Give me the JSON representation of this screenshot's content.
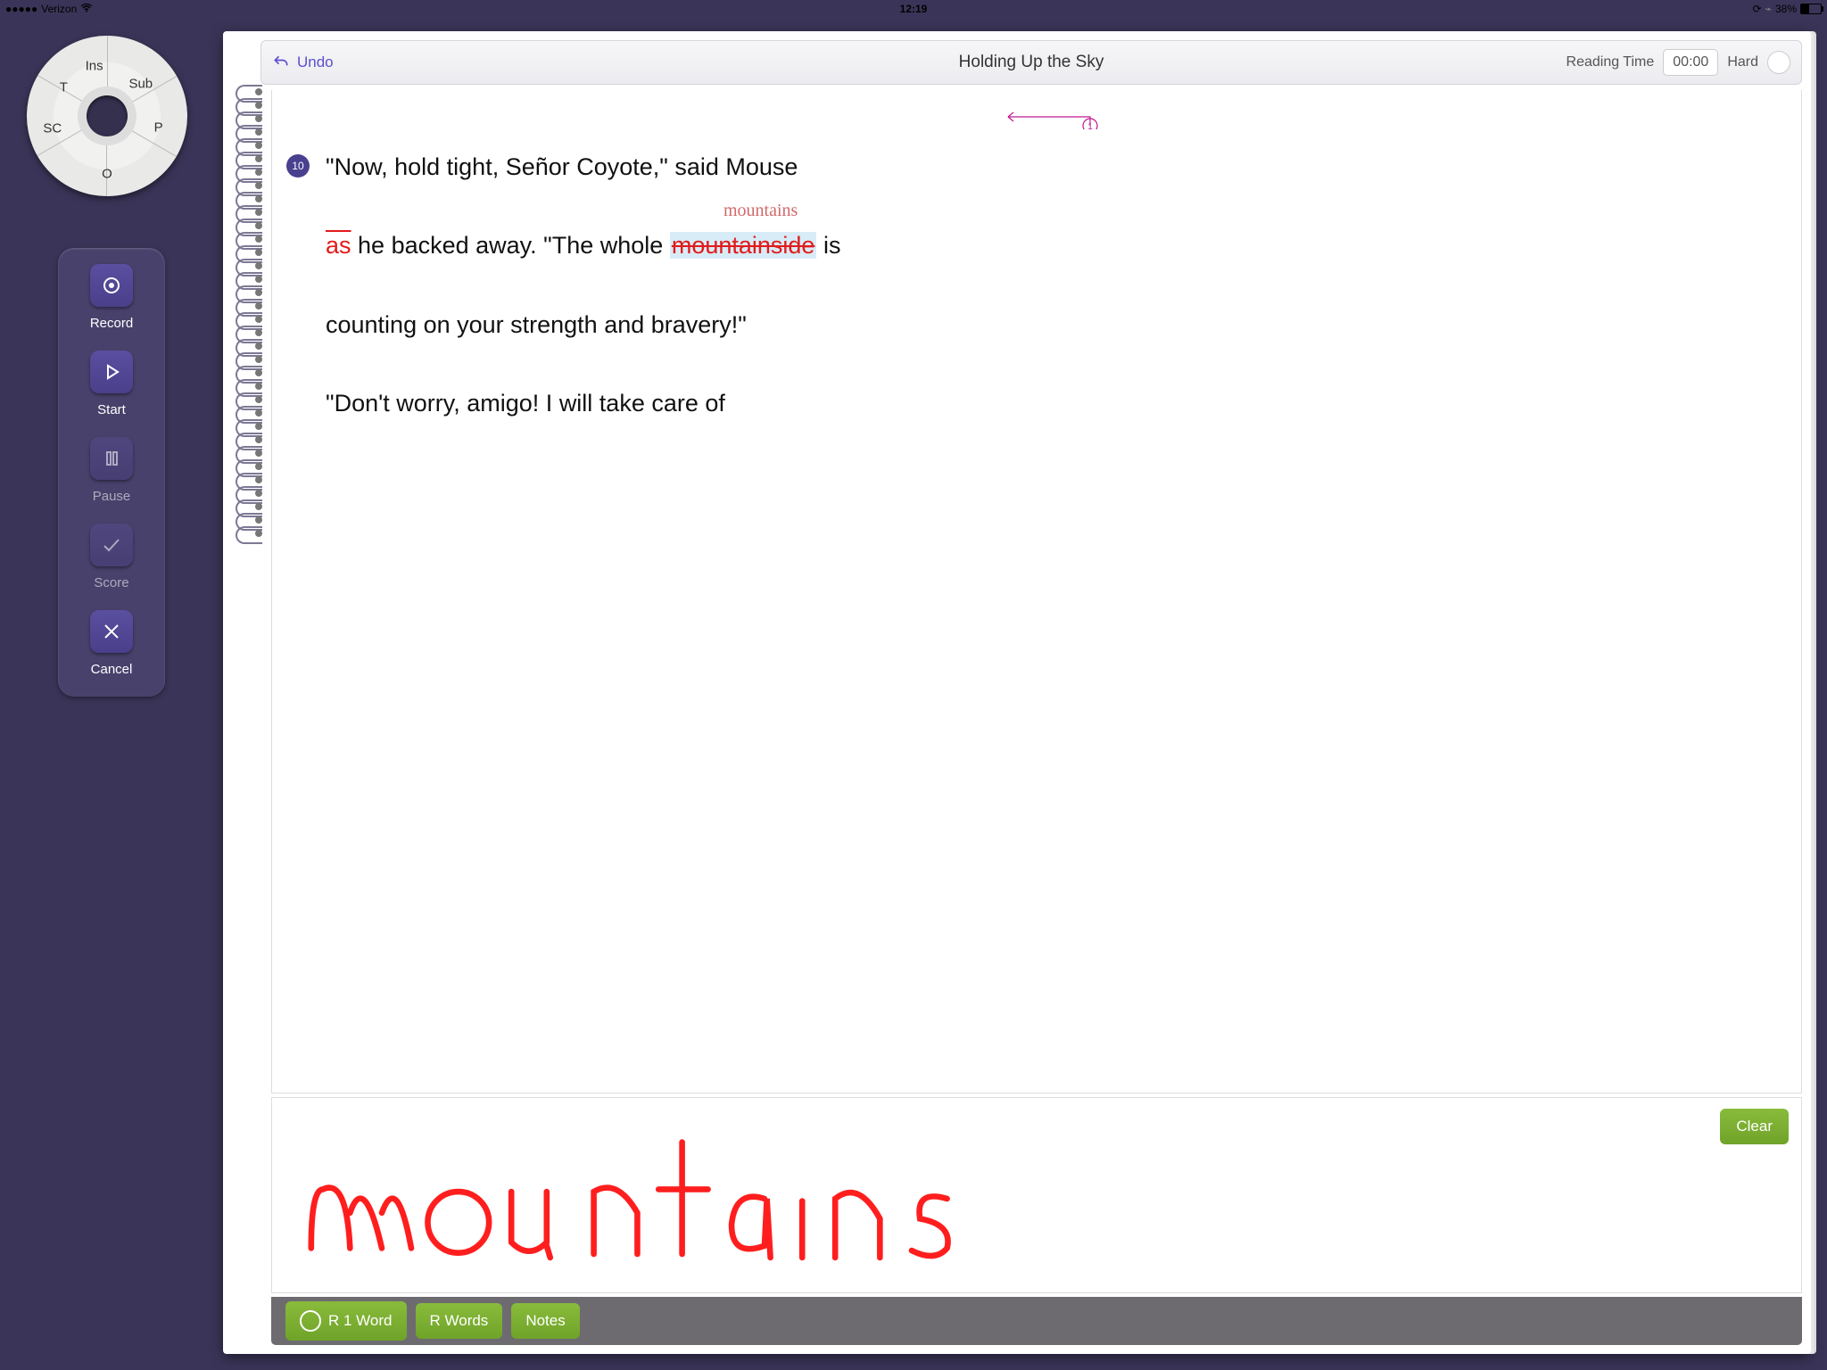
{
  "status": {
    "carrier": "Verizon",
    "time": "12:19",
    "battery_pct": "38%"
  },
  "wheel": {
    "ins": "Ins",
    "sub": "Sub",
    "t": "T",
    "p": "P",
    "sc": "SC",
    "o": "O"
  },
  "side": {
    "record": "Record",
    "start": "Start",
    "pause": "Pause",
    "score": "Score",
    "cancel": "Cancel"
  },
  "toolbar": {
    "undo": "Undo",
    "title": "Holding Up the Sky",
    "reading_time_label": "Reading Time",
    "timer": "00:00",
    "hard": "Hard"
  },
  "passage": {
    "line_number": "10",
    "return_count": "1",
    "line1_a": "\"Now, hold tight, Señor Coyote,\" said Mouse",
    "line2_as": "as",
    "line2_b": " he backed away. \"The whole ",
    "line2_strike": "mountainside",
    "line2_c": " is",
    "sub_word": "mountains",
    "line3": "counting on your strength and bravery!\"",
    "line4": "\"Don't worry, amigo! I will take care of"
  },
  "writepad": {
    "clear": "Clear",
    "handwriting": "mountains"
  },
  "bottom": {
    "r1": "R 1 Word",
    "rw": "R Words",
    "notes": "Notes"
  }
}
